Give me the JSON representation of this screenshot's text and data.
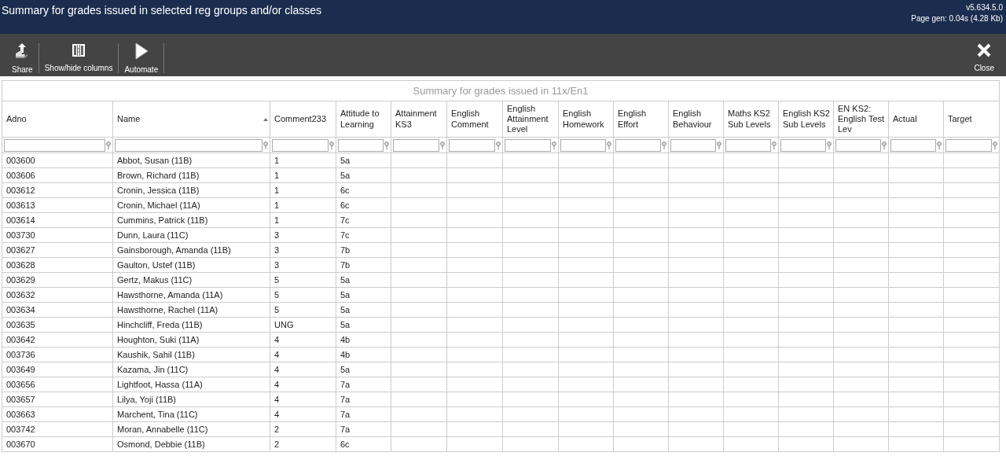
{
  "header": {
    "title": "Summary for grades issued in selected reg groups and/or classes",
    "version": "v5.634.5.0",
    "page_gen": "Page gen: 0.04s (4.28 Kb)"
  },
  "toolbar": [
    {
      "kind": "share",
      "label": "Share"
    },
    {
      "kind": "columns",
      "label": "Show/hide columns"
    },
    {
      "kind": "play",
      "label": "Automate"
    }
  ],
  "close_button": {
    "label": "Close"
  },
  "table": {
    "caption": "Summary for grades issued in 11x/En1",
    "columns": [
      {
        "label": "Adno",
        "sorted": false
      },
      {
        "label": "Name",
        "sorted": true
      },
      {
        "label": "Comment233",
        "sorted": false
      },
      {
        "label": "Attitude to Learning",
        "sorted": false
      },
      {
        "label": "Attainment KS3",
        "sorted": false
      },
      {
        "label": "English Comment",
        "sorted": false
      },
      {
        "label": "English Attainment Level",
        "sorted": false
      },
      {
        "label": "English Homework",
        "sorted": false
      },
      {
        "label": "English Effort",
        "sorted": false
      },
      {
        "label": "English Behaviour",
        "sorted": false
      },
      {
        "label": "Maths KS2 Sub Levels",
        "sorted": false
      },
      {
        "label": "English KS2 Sub Levels",
        "sorted": false
      },
      {
        "label": "EN KS2: English Test Lev",
        "sorted": false
      },
      {
        "label": "Actual",
        "sorted": false
      },
      {
        "label": "Target",
        "sorted": false
      }
    ],
    "rows": [
      [
        "003600",
        "Abbot, Susan (11B)",
        "1",
        "5a"
      ],
      [
        "003606",
        "Brown, Richard (11B)",
        "1",
        "5a"
      ],
      [
        "003612",
        "Cronin, Jessica (11B)",
        "1",
        "6c"
      ],
      [
        "003613",
        "Cronin, Michael (11A)",
        "1",
        "6c"
      ],
      [
        "003614",
        "Cummins, Patrick (11B)",
        "1",
        "7c"
      ],
      [
        "003730",
        "Dunn, Laura (11C)",
        "3",
        "7c"
      ],
      [
        "003627",
        "Gainsborough, Amanda (11B)",
        "3",
        "7b"
      ],
      [
        "003628",
        "Gaulton, Ustef (11B)",
        "3",
        "7b"
      ],
      [
        "003629",
        "Gertz, Makus (11C)",
        "5",
        "5a"
      ],
      [
        "003632",
        "Hawsthorne, Amanda (11A)",
        "5",
        "5a"
      ],
      [
        "003634",
        "Hawsthorne, Rachel (11A)",
        "5",
        "5a"
      ],
      [
        "003635",
        "Hinchcliff, Freda (11B)",
        "UNG",
        "5a"
      ],
      [
        "003642",
        "Houghton, Suki (11A)",
        "4",
        "4b"
      ],
      [
        "003736",
        "Kaushik, Sahil (11B)",
        "4",
        "4b"
      ],
      [
        "003649",
        "Kazama, Jin (11C)",
        "4",
        "5a"
      ],
      [
        "003656",
        "Lightfoot, Hassa (11A)",
        "4",
        "7a"
      ],
      [
        "003657",
        "Lilya, Yoji (11B)",
        "4",
        "7a"
      ],
      [
        "003663",
        "Marchent, Tina (11C)",
        "4",
        "7a"
      ],
      [
        "003742",
        "Moran, Annabelle (11C)",
        "2",
        "7a"
      ],
      [
        "003670",
        "Osmond, Debbie (11B)",
        "2",
        "6c"
      ]
    ]
  }
}
